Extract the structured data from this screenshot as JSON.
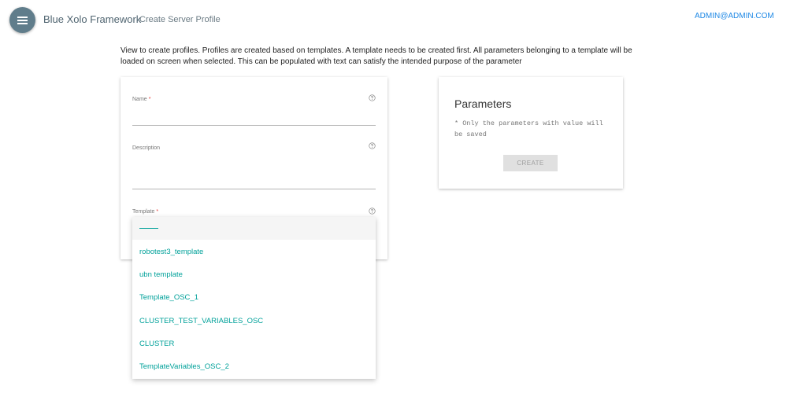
{
  "header": {
    "app_title": "Blue Xolo Framework",
    "page_subtitle": "Create Server Profile",
    "user_email": "ADMIN@ADMIN.COM"
  },
  "intro_text": "View to create profiles. Profiles are created based on templates. A template needs to be created first. All parameters belonging to a template will be loaded on screen when selected. This can be populated with text can satisfy the intended purpose of the parameter",
  "form": {
    "name_label": "Name",
    "name_value": "",
    "description_label": "Description",
    "description_value": "",
    "template_label": "Template",
    "required_marker": "*"
  },
  "template_options": [
    "",
    "robotest3_template",
    "ubn template",
    "Template_OSC_1",
    "CLUSTER_TEST_VARIABLES_OSC",
    "CLUSTER",
    "TemplateVariables_OSC_2"
  ],
  "parameters": {
    "title": "Parameters",
    "note": "* Only the parameters with value will be saved",
    "create_label": "CREATE"
  },
  "colors": {
    "menu_button": "#607d8b",
    "accent": "#00a19a",
    "link": "#1e88e5",
    "required": "#e53935"
  },
  "icons": {
    "menu": "menu-icon",
    "help": "help-circle-icon"
  }
}
